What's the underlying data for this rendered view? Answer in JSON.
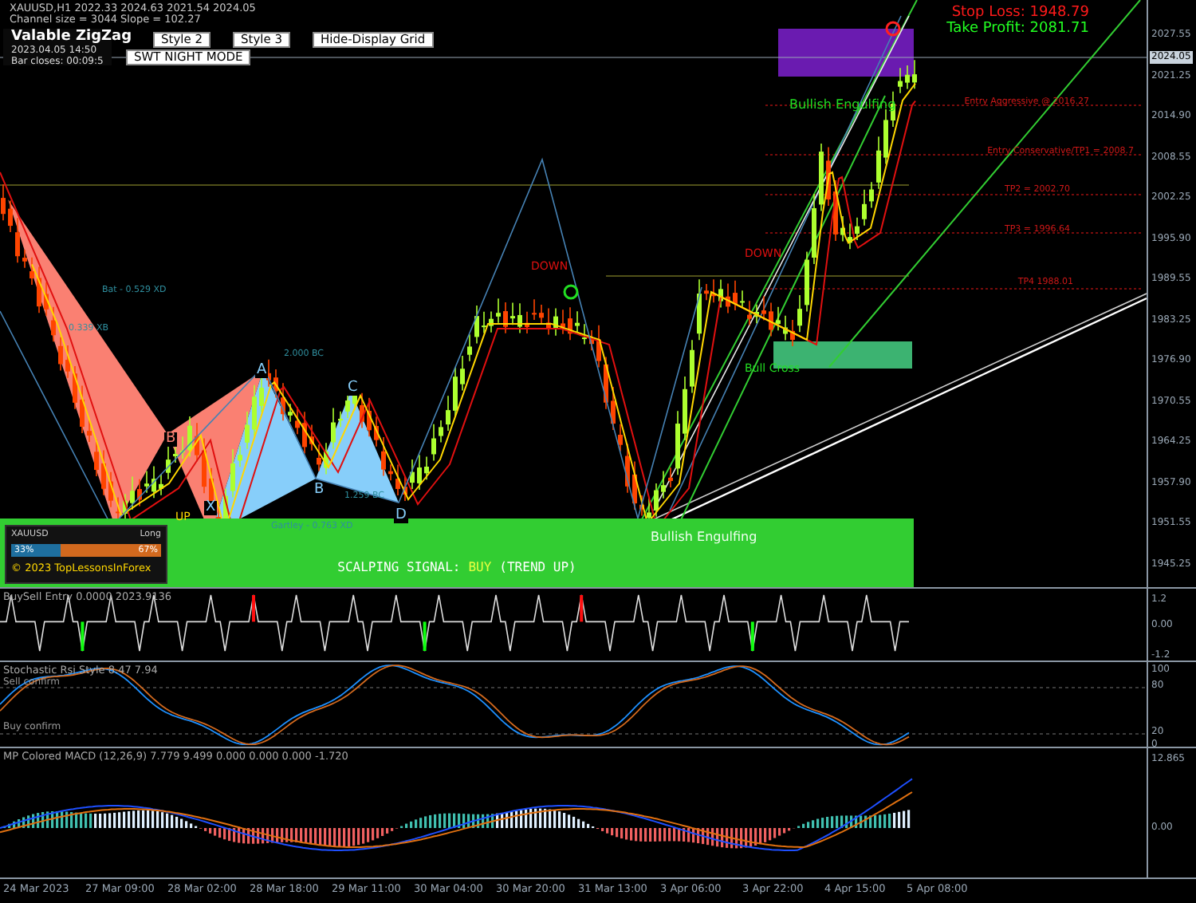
{
  "chart_header": {
    "title": "XAUUSD,H1  2022.33 2024.63 2021.54 2024.05",
    "channel": "Channel size = 3044 Slope = 102.27"
  },
  "zigzag_box": {
    "title": "Valable ZigZag",
    "time": "2023.04.05 14:50",
    "bar_closes": "Bar closes: 00:09:5"
  },
  "buttons": [
    {
      "label": "Style 2"
    },
    {
      "label": "Style 3"
    },
    {
      "label": "Hide-Display Grid"
    }
  ],
  "night_mode_button": {
    "label": "SWT NIGHT MODE"
  },
  "chart_labels": [
    {
      "kind": "stop",
      "text": "Stop Loss: 1948.79"
    },
    {
      "kind": "profit",
      "text": "Take Profit: 2081.71"
    },
    {
      "kind": "pattern",
      "text": "Bullish Engulfing"
    },
    {
      "kind": "entry",
      "text": "Entry Aggressive @ 2016.27"
    },
    {
      "kind": "entry",
      "text": "Entry Conservative/TP1 = 2008.7"
    },
    {
      "kind": "entry",
      "text": "TP2 = 2002.70"
    },
    {
      "kind": "entry",
      "text": "TP3 = 1996.64"
    },
    {
      "kind": "entry",
      "text": "TP4 1988.01"
    },
    {
      "kind": "down",
      "text": "DOWN"
    },
    {
      "kind": "down",
      "text": "DOWN"
    },
    {
      "kind": "pattern",
      "text": "Bull Cross"
    },
    {
      "kind": "harmonic",
      "text": "Bat - 0.529 XD"
    },
    {
      "kind": "harmonic",
      "text": "0.339 XB"
    },
    {
      "kind": "harmonic",
      "text": "2.000 BC"
    },
    {
      "kind": "point",
      "text": "A"
    },
    {
      "kind": "bearpoint",
      "text": "B"
    },
    {
      "kind": "point",
      "text": "B"
    },
    {
      "kind": "point",
      "text": "C"
    },
    {
      "kind": "point",
      "text": "D"
    },
    {
      "kind": "point",
      "text": "X"
    },
    {
      "kind": "harmonic",
      "text": "1.259 BC"
    },
    {
      "kind": "up",
      "text": "UP"
    },
    {
      "kind": "harmonic",
      "text": "Gartley - 0.763 XD"
    },
    {
      "kind": "bandpattern",
      "text": "Bullish Engulfing"
    }
  ],
  "price_axis": {
    "ticks": [
      "2027.55",
      "2021.25",
      "2014.90",
      "2008.55",
      "2002.25",
      "1995.90",
      "1989.55",
      "1983.25",
      "1976.90",
      "1970.55",
      "1964.25",
      "1957.90",
      "1951.55",
      "1945.25"
    ],
    "current": "2024.05"
  },
  "scalping_signal": {
    "label": "SCALPING SIGNAL:",
    "signal": "BUY",
    "trend": "(TREND UP)"
  },
  "sentiment": {
    "symbol": "XAUUSD",
    "side": "Long",
    "long_pct": "33%",
    "short_pct": "67%",
    "level": 0.33,
    "footer": "© 2023 TopLessonsInForex"
  },
  "indicators": [
    {
      "kind": "buysell",
      "title": "BuySell Entry 0.0000 2023.9136",
      "ticks": [
        "1.2",
        "0.00",
        "-1.2"
      ]
    },
    {
      "kind": "stoch",
      "title": "Stochastic Rsi Style 8.47 7.94",
      "levels": [
        "Sell confirm",
        "Buy confirm"
      ],
      "ticks": [
        "100",
        "80",
        "20",
        "0"
      ]
    },
    {
      "kind": "macd",
      "title": "MP Colored MACD (12,26,9) 7.779 9.499 0.000 0.000 0.000 -1.720",
      "ticks": [
        "12.865",
        "0.00"
      ]
    }
  ],
  "time_axis": [
    "24 Mar 2023",
    "27 Mar 09:00",
    "28 Mar 02:00",
    "28 Mar 18:00",
    "29 Mar 11:00",
    "30 Mar 04:00",
    "30 Mar 20:00",
    "31 Mar 13:00",
    "3 Apr 06:00",
    "3 Apr 22:00",
    "4 Apr 15:00",
    "5 Apr 08:00"
  ]
}
